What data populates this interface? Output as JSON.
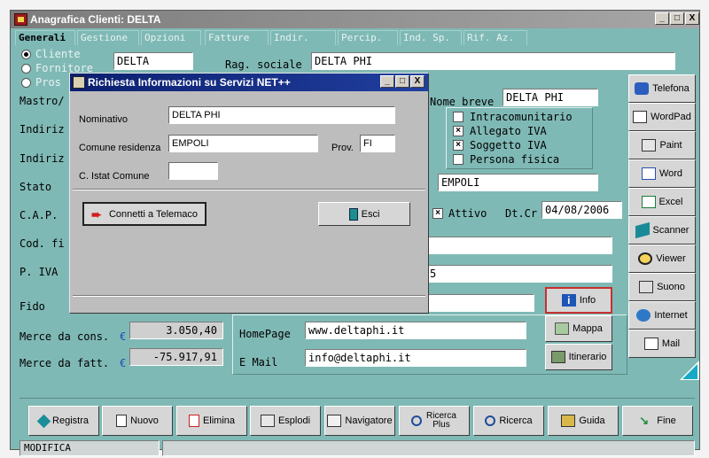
{
  "window": {
    "title": "Anagrafica Clienti: DELTA",
    "controls": [
      "_",
      "□",
      "X"
    ]
  },
  "tabs": [
    "Generali",
    "Gestione",
    "Opzioni",
    "Fatture",
    "Indir.",
    "Percip.",
    "Ind. Sp.",
    "Rif. Az."
  ],
  "form": {
    "radio_cliente": "Cliente",
    "radio_fornitore": "Fornitore",
    "radio_prospect": "Pros",
    "code_value": "DELTA",
    "rag_sociale_label": "Rag. sociale",
    "rag_sociale_value": "DELTA PHI",
    "mastro_label": "Mastro/",
    "indirizzo1_label": "Indiriz",
    "indirizzo2_label": "Indiriz",
    "stato_label": "Stato",
    "cap_label": "C.A.P.",
    "cod_fisc_label": "Cod. fi",
    "piva_label": "P. IVA",
    "fido_label": "Fido",
    "merce_cons_label": "Merce da cons.",
    "merce_cons_value": "3.050,40",
    "merce_fatt_label": "Merce da fatt.",
    "merce_fatt_value": "-75.917,91",
    "euro_symbol": "€",
    "nome_breve_label": "Nome breve",
    "nome_breve_value": "DELTA PHI",
    "chk_intra": "Intracomunitario",
    "chk_allegato": "Allegato IVA",
    "chk_soggetto": "Soggetto IVA",
    "chk_persona": "Persona fisica",
    "comune_value": "EMPOLI",
    "attivo_label": "Attivo",
    "dtcr_label": "Dt.Cr",
    "dtcr_value": "04/08/2006",
    "piva_tail": "5",
    "homepage_label": "HomePage",
    "homepage_value": "www.deltaphi.it",
    "email_label": "E Mail",
    "email_value": "info@deltaphi.it",
    "info_button": "Info",
    "mappa_button": "Mappa",
    "itinerario_button": "Itinerario"
  },
  "side_buttons": [
    "Telefona",
    "WordPad",
    "Paint",
    "Word",
    "Excel",
    "Scanner",
    "Viewer",
    "Suono",
    "Internet",
    "Mail"
  ],
  "bottom_buttons": [
    "Registra",
    "Nuovo",
    "Elimina",
    "Esplodi",
    "Navigatore",
    "Ricerca Plus",
    "Ricerca",
    "Guida",
    "Fine"
  ],
  "status": {
    "mode": "MODIFICA"
  },
  "dialog": {
    "title": "Richiesta Informazioni su Servizi NET++",
    "nominativo_label": "Nominativo",
    "nominativo_value": "DELTA PHI",
    "comune_label": "Comune residenza",
    "comune_value": "EMPOLI",
    "prov_label": "Prov.",
    "prov_value": "FI",
    "istat_label": "C. Istat Comune",
    "istat_value": "",
    "connect_button": "Connetti a Telemaco",
    "exit_button": "Esci"
  }
}
